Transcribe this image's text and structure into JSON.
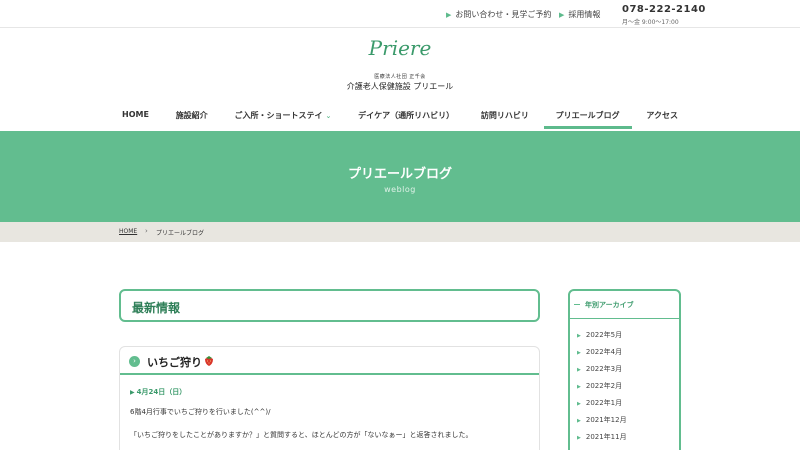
{
  "topbar": {
    "contact": "お問い合わせ・見学ご予約",
    "recruit": "採用情報",
    "tel": "078-222-2140",
    "hours": "月〜金 9:00〜17:00"
  },
  "logo": {
    "mark": "Priere",
    "corp": "医療法人社団 正千会",
    "name": "介護老人保健施設 プリエール"
  },
  "nav": [
    {
      "label": "HOME"
    },
    {
      "label": "施設紹介"
    },
    {
      "label": "ご入所・ショートステイ"
    },
    {
      "label": "デイケア（通所リハビリ）"
    },
    {
      "label": "訪問リハビリ"
    },
    {
      "label": "プリエールブログ"
    },
    {
      "label": "アクセス"
    }
  ],
  "hero": {
    "title": "プリエールブログ",
    "subtitle": "weblog"
  },
  "breadcrumb": {
    "home": "HOME",
    "sep": "›",
    "current": "プリエールブログ"
  },
  "main": {
    "section_title": "最新情報",
    "post": {
      "title": "いちご狩り",
      "date": "4月24日（日）",
      "line1": "6階4月行事でいちご狩りを行いました(^^)/",
      "line2": "「いちご狩りをしたことがありますか？」と質問すると、ほとんどの方が「ないなぁー」と返答されました。"
    }
  },
  "sidebar": {
    "title": "年別アーカイブ",
    "items": [
      "2022年5月",
      "2022年4月",
      "2022年3月",
      "2022年2月",
      "2022年1月",
      "2021年12月",
      "2021年11月"
    ]
  },
  "colors": {
    "accent": "#62bd8f",
    "accent_dark": "#2f7f58",
    "breadcrumb_bg": "#e8e6e0"
  }
}
